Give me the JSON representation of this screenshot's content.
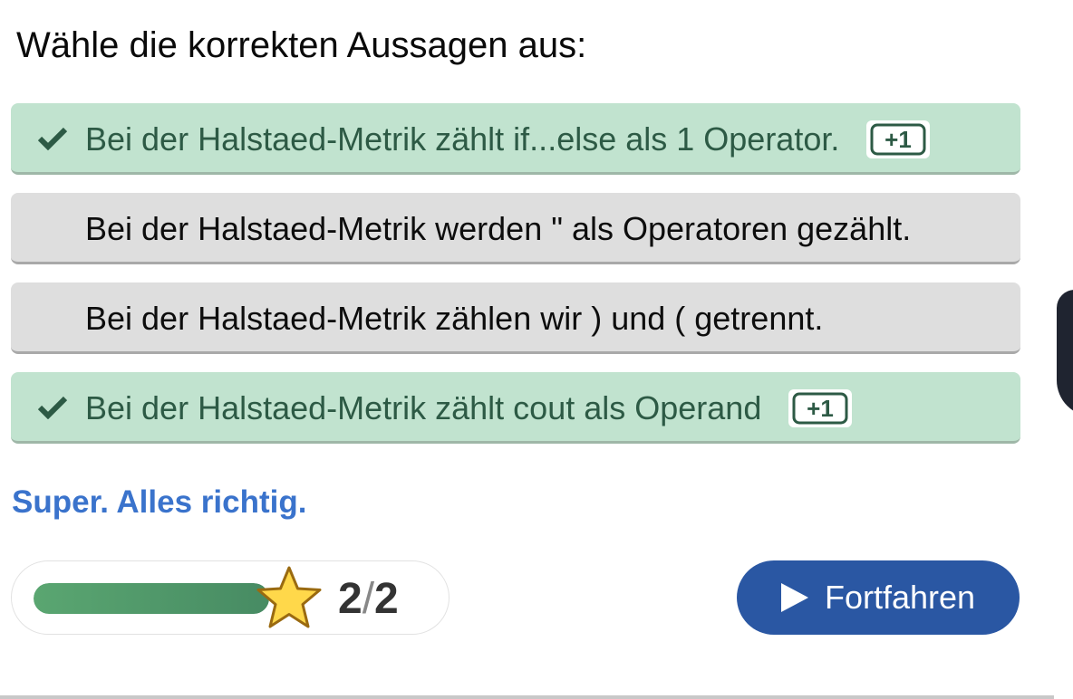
{
  "question": "Wähle die korrekten Aussagen aus:",
  "answers": [
    {
      "text": "Bei der Halstaed-Metrik zählt if...else als 1 Operator.",
      "correct": true,
      "badge": "+1"
    },
    {
      "text": "Bei der Halstaed-Metrik werden \" als Operatoren gezählt.",
      "correct": false,
      "badge": ""
    },
    {
      "text": "Bei der Halstaed-Metrik zählen wir ) und ( getrennt.",
      "correct": false,
      "badge": ""
    },
    {
      "text": "Bei der Halstaed-Metrik zählt cout als Operand",
      "correct": true,
      "badge": "+1"
    }
  ],
  "feedback": "Super. Alles richtig.",
  "score": {
    "current": "2",
    "separator": "/",
    "total": "2",
    "progress": 1.0
  },
  "continue_label": "Fortfahren",
  "icons": {
    "check": "check-icon",
    "badge": "plus-one-badge-icon",
    "star": "star-icon",
    "play": "play-icon"
  },
  "colors": {
    "correct_bg": "#c1e3cf",
    "correct_text": "#2d5a45",
    "neutral_bg": "#dedede",
    "feedback": "#3a73cc",
    "button": "#2a57a3",
    "progress": "#5aa671"
  }
}
